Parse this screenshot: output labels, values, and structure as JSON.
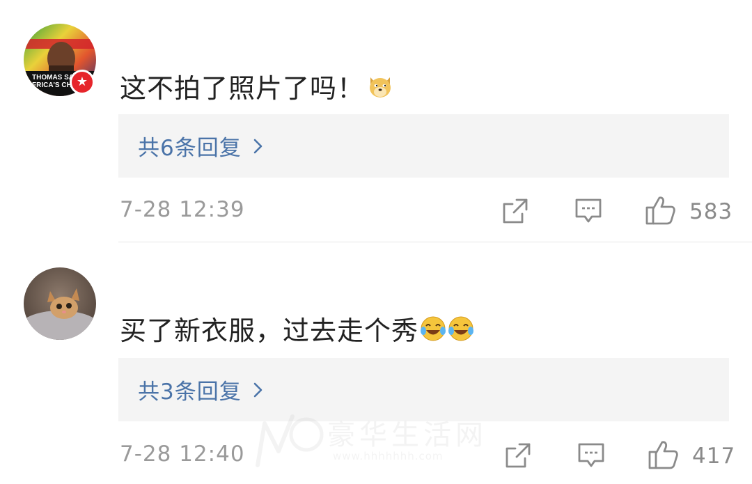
{
  "comments": [
    {
      "avatar_caption_line1": "THOMAS SA",
      "avatar_caption_line2": "FRICA'S CH",
      "verified": true,
      "text": "这不拍了照片了吗！",
      "emojis": [
        "doge-emoji"
      ],
      "replies_label": "共6条回复",
      "timestamp": "7-28 12:39",
      "likes": "583"
    },
    {
      "avatar_caption_line1": "",
      "avatar_caption_line2": "",
      "verified": false,
      "text": "买了新衣服，过去走个秀",
      "emojis": [
        "laugh-cry-emoji",
        "laugh-cry-emoji"
      ],
      "replies_label": "共3条回复",
      "timestamp": "7-28 12:40",
      "likes": "417"
    }
  ],
  "icons": {
    "share": "share-icon",
    "reply": "comment-icon",
    "like": "thumbs-up-icon",
    "chevron": "chevron-right-icon"
  },
  "colors": {
    "reply_link": "#4a73a8",
    "meta_gray": "#9a9a9a",
    "reply_box_bg": "#f4f4f4",
    "verified_badge": "#e6252b"
  },
  "watermark": {
    "title": "豪华生活网",
    "url": "www.hhhhhhh.com"
  }
}
